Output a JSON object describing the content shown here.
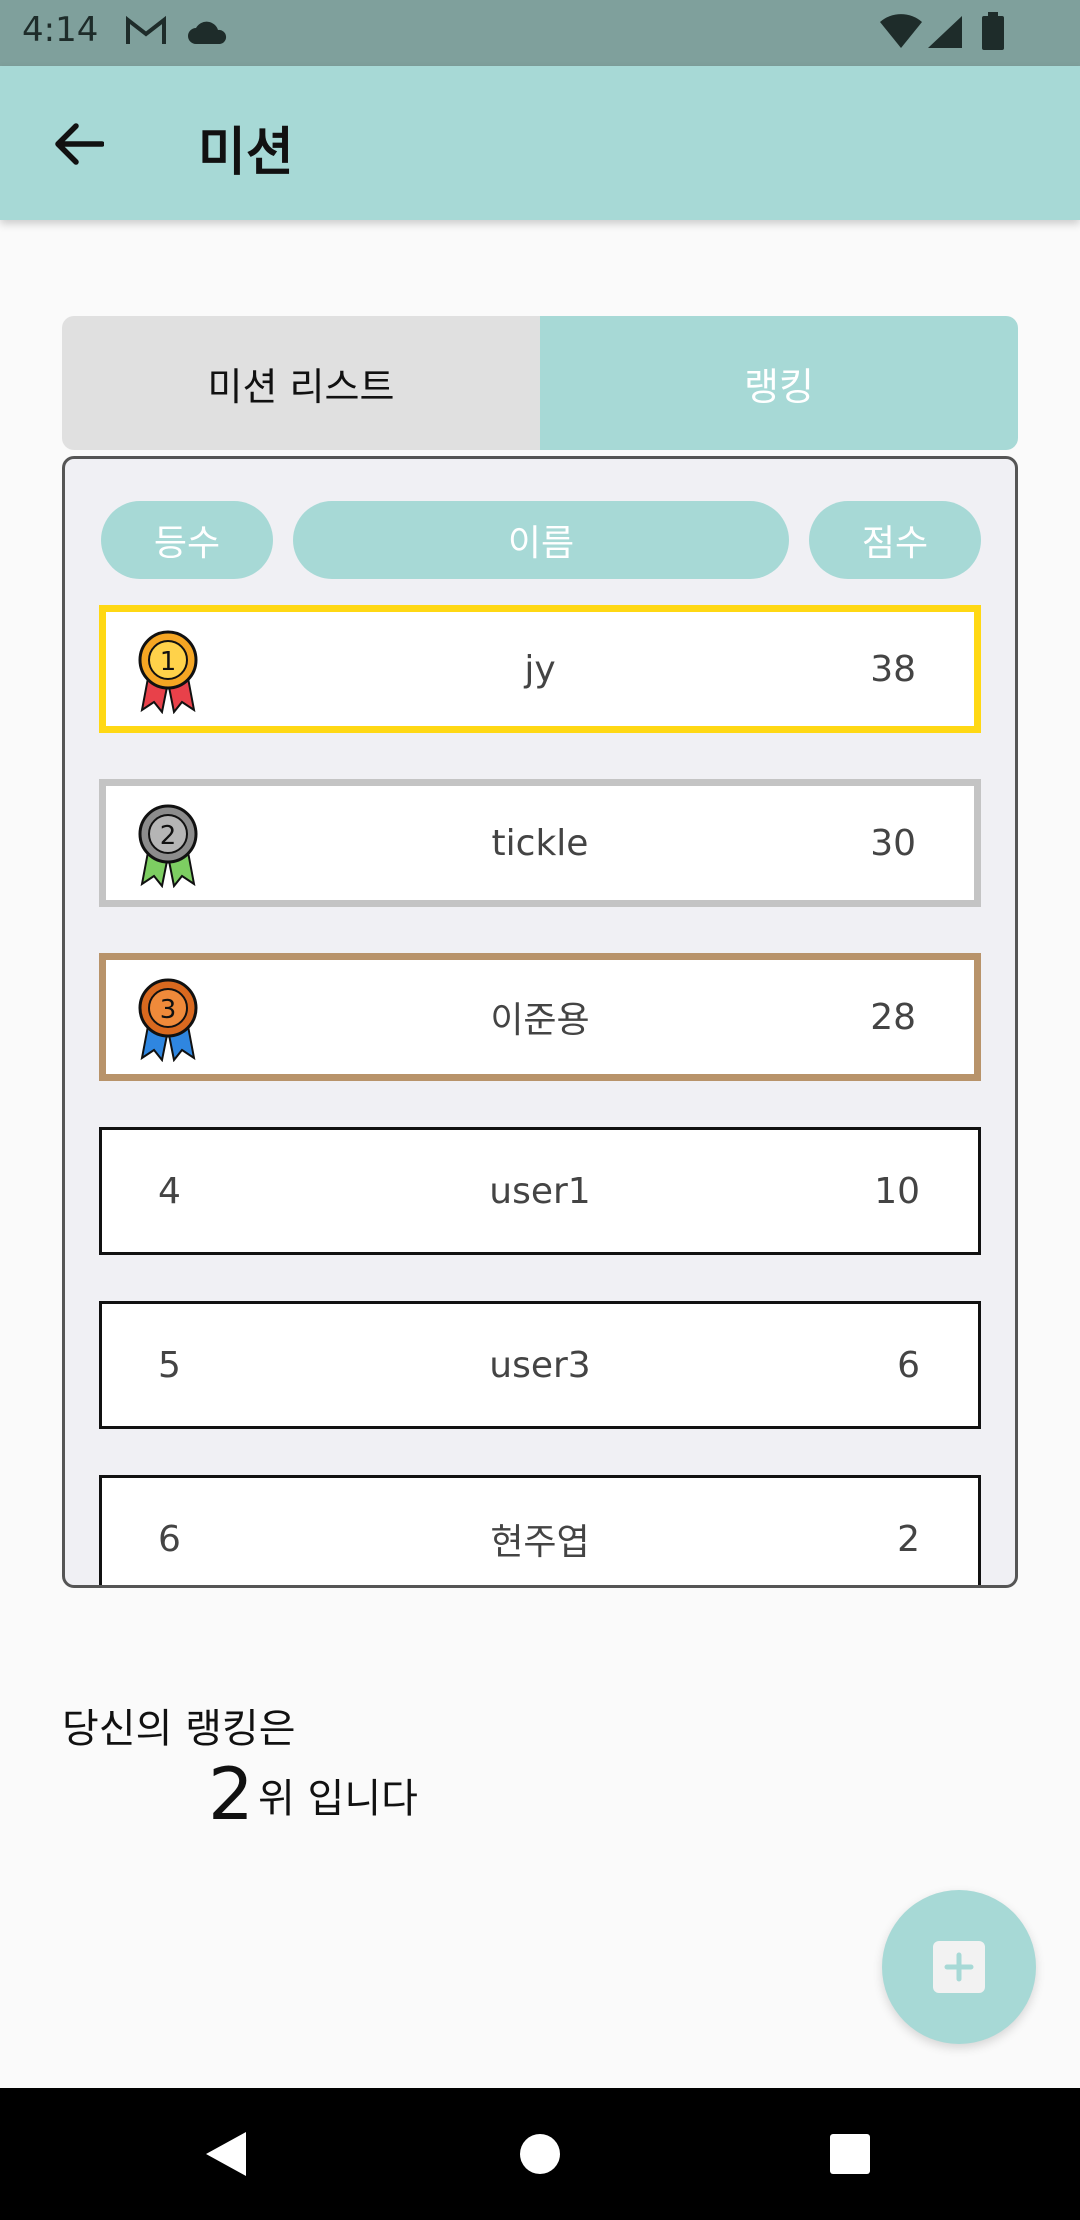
{
  "status_bar": {
    "time": "4:14"
  },
  "app_bar": {
    "title": "미션"
  },
  "tabs": [
    {
      "label": "미션 리스트",
      "selected": false
    },
    {
      "label": "랭킹",
      "selected": true
    }
  ],
  "ranking": {
    "headers": {
      "rank": "등수",
      "name": "이름",
      "score": "점수"
    },
    "rows": [
      {
        "rank": "1",
        "name": "jy",
        "score": "38",
        "medal": "gold-medal-icon"
      },
      {
        "rank": "2",
        "name": "tickle",
        "score": "30",
        "medal": "silver-medal-icon"
      },
      {
        "rank": "3",
        "name": "이준용",
        "score": "28",
        "medal": "bronze-medal-icon"
      },
      {
        "rank": "4",
        "name": "user1",
        "score": "10"
      },
      {
        "rank": "5",
        "name": "user3",
        "score": "6"
      },
      {
        "rank": "6",
        "name": "현주엽",
        "score": "2"
      }
    ]
  },
  "my_rank": {
    "label": "당신의 랭킹은",
    "value": "2",
    "suffix": "위 입니다"
  },
  "colors": {
    "accent": "#a7d9d6",
    "status_bar": "#7fa09c",
    "gold": "#ffd814",
    "silver": "#c4c4c4",
    "bronze": "#b8936a"
  },
  "icons": {
    "fab": "plus-icon",
    "back": "arrow-left-icon"
  }
}
